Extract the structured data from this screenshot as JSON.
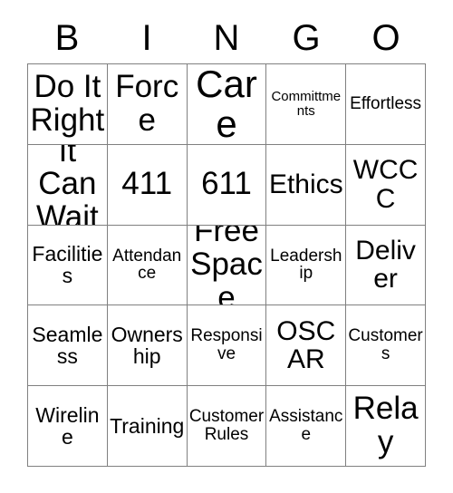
{
  "card": {
    "header": {
      "letters": [
        "B",
        "I",
        "N",
        "G",
        "O"
      ]
    },
    "rows": [
      [
        {
          "text": "Do It Right",
          "size": "lg"
        },
        {
          "text": "Force",
          "size": "lg"
        },
        {
          "text": "Care",
          "size": "xl"
        },
        {
          "text": "Committments",
          "size": "xxs"
        },
        {
          "text": "Effortless",
          "size": "xs"
        }
      ],
      [
        {
          "text": "It Can Wait",
          "size": "lg"
        },
        {
          "text": "411",
          "size": "lg"
        },
        {
          "text": "611",
          "size": "lg"
        },
        {
          "text": "Ethics",
          "size": "md"
        },
        {
          "text": "WCCC",
          "size": "md"
        }
      ],
      [
        {
          "text": "Facilities",
          "size": "sm"
        },
        {
          "text": "Attendance",
          "size": "xs"
        },
        {
          "text": "Free Space",
          "size": "lg"
        },
        {
          "text": "Leadership",
          "size": "xs"
        },
        {
          "text": "Deliver",
          "size": "md"
        }
      ],
      [
        {
          "text": "Seamless",
          "size": "sm"
        },
        {
          "text": "Ownership",
          "size": "sm"
        },
        {
          "text": "Responsive",
          "size": "xs"
        },
        {
          "text": "OSCAR",
          "size": "md"
        },
        {
          "text": "Customers",
          "size": "xs"
        }
      ],
      [
        {
          "text": "Wireline",
          "size": "sm"
        },
        {
          "text": "Training",
          "size": "sm"
        },
        {
          "text": "Customer Rules",
          "size": "xs"
        },
        {
          "text": "Assistance",
          "size": "xs"
        },
        {
          "text": "Relay",
          "size": "lg"
        }
      ]
    ],
    "free_space_index": {
      "row": 2,
      "col": 2
    },
    "colors": {
      "background": "#ffffff",
      "text": "#000000",
      "grid_line": "#808080"
    }
  }
}
